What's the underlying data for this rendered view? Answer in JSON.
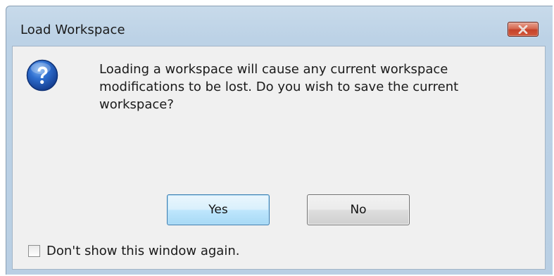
{
  "window": {
    "title": "Load Workspace"
  },
  "dialog": {
    "icon": "question-icon",
    "message": "Loading a workspace will cause any current workspace modifications to be lost. Do you wish to save the current workspace?"
  },
  "buttons": {
    "yes_label": "Yes",
    "no_label": "No"
  },
  "checkbox": {
    "label": "Don't show this window again.",
    "checked": false
  },
  "colors": {
    "frame": "#bcd2e6",
    "client": "#f0f0f0",
    "close_button": "#c5422a",
    "default_button_border": "#3c7fb1"
  }
}
